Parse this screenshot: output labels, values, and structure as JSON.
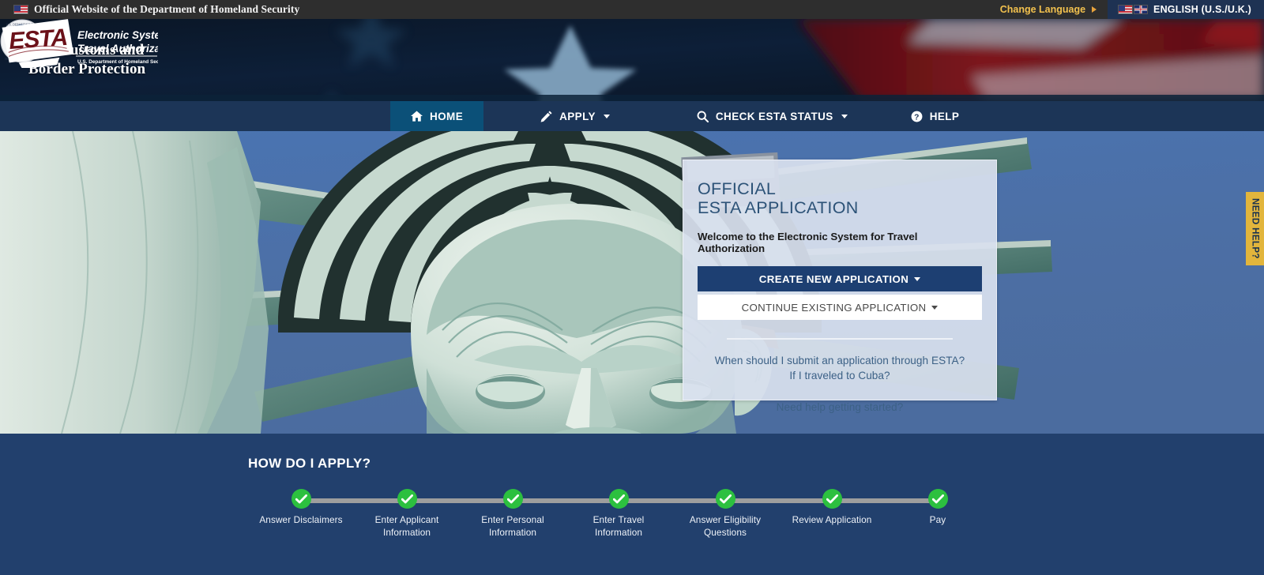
{
  "gov_bar": {
    "flag_icon": "us-flag-icon",
    "official_text": "Official Website of the Department of Homeland Security",
    "change_language": "Change Language",
    "change_language_arrow": "triangle-right-icon",
    "language_selected": "ENGLISH (U.S./U.K.)",
    "language_flags_icon": "us-uk-flags-icon"
  },
  "header": {
    "seal_icon": "dhs-seal-icon",
    "agency_line1": "U.S. Customs and",
    "agency_line2": "Border Protection",
    "esta_logo": {
      "mark": "ESTA",
      "line1": "Electronic System for",
      "line2": "Travel Authorization",
      "line3": "U.S. Department of Homeland Security ®"
    }
  },
  "nav": {
    "items": [
      {
        "label": "HOME",
        "icon": "home-icon",
        "active": true,
        "caret": false
      },
      {
        "label": "APPLY",
        "icon": "pencil-icon",
        "active": false,
        "caret": true
      },
      {
        "label": "CHECK ESTA STATUS",
        "icon": "search-icon",
        "active": false,
        "caret": true
      },
      {
        "label": "HELP",
        "icon": "question-circle-icon",
        "active": false,
        "caret": false
      }
    ]
  },
  "card": {
    "title_line1": "OFFICIAL",
    "title_line2": "ESTA APPLICATION",
    "welcome": "Welcome to the Electronic System for Travel Authorization",
    "primary_button": "CREATE NEW APPLICATION",
    "secondary_button": "CONTINUE EXISTING APPLICATION",
    "links": [
      "When should I submit an application through ESTA?",
      "If I traveled to Cuba?",
      "Need help getting started?"
    ]
  },
  "need_help_tab": {
    "label": "NEED HELP?"
  },
  "apply_section": {
    "title": "HOW DO I APPLY?",
    "steps": [
      {
        "label": "Answer Disclaimers",
        "status_icon": "check-circle-icon"
      },
      {
        "label": "Enter Applicant Information",
        "status_icon": "check-circle-icon"
      },
      {
        "label": "Enter Personal Information",
        "status_icon": "check-circle-icon"
      },
      {
        "label": "Enter Travel Information",
        "status_icon": "check-circle-icon"
      },
      {
        "label": "Answer Eligibility Questions",
        "status_icon": "check-circle-icon"
      },
      {
        "label": "Review Application",
        "status_icon": "check-circle-icon"
      },
      {
        "label": "Pay",
        "status_icon": "check-circle-icon"
      }
    ]
  },
  "colors": {
    "gov_bar_bg": "#2e2e2e",
    "accent_yellow": "#f2c14e",
    "nav_bg": "#1c3557",
    "nav_active_bg": "#0b5078",
    "primary_button_bg": "#1d3f72",
    "card_bg": "#d8e0ee",
    "need_help_bg": "#e2b53c",
    "apply_section_bg": "#22406d",
    "step_green": "#2cc03f",
    "hero_sky": "#4c6fa5"
  }
}
